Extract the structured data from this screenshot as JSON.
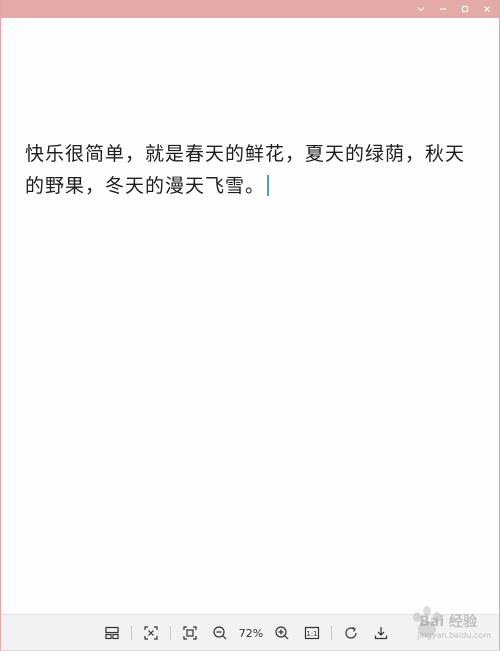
{
  "titlebar": {
    "color": "#e3aaa7",
    "controls": [
      "chevron-down-icon",
      "minimize-icon",
      "maximize-icon",
      "close-icon"
    ]
  },
  "document": {
    "text": "快乐很简单，就是春天的鲜花，夏天的绿荫，秋天的野果，冬天的漫天飞雪。"
  },
  "toolbar": {
    "buttons": [
      "thumbnail-layout-icon",
      "fit-window-icon",
      "fullscreen-icon",
      "zoom-out-icon",
      "zoom-in-icon",
      "actual-size-icon",
      "rotate-icon",
      "download-icon"
    ],
    "zoom_level": "72%",
    "actual_size_label": "1:1"
  },
  "watermark": {
    "text": "Bai 经验",
    "sub": "jingyan.baidu.com"
  }
}
